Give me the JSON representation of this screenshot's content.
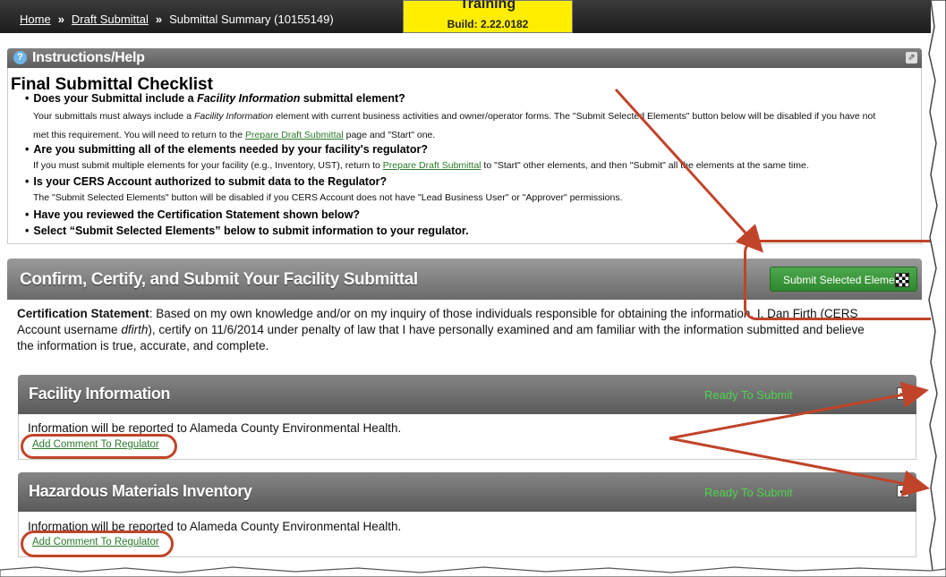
{
  "breadcrumb": {
    "home": "Home",
    "sep": "»",
    "draft": "Draft Submittal",
    "current": "Submittal Summary (10155149)"
  },
  "build_badge": {
    "environment": "Training",
    "build": "Build: 2.22.0182"
  },
  "instructions": {
    "header": "Instructions/Help",
    "checklist_title": "Final Submittal Checklist",
    "items": [
      {
        "q_pre": "Does your Submittal include a ",
        "q_em": "Facility Information",
        "q_post": " submittal element?",
        "d1_pre": "Your submittals must always include a ",
        "d1_em": "Facility Information",
        "d1_post": " element with current business activities and owner/operator forms. The \"Submit Selected Elements\" button below will be disabled if you have not",
        "d2_pre": "met this requirement. You will need to return to the ",
        "d2_link": "Prepare Draft Submittal",
        "d2_post": " page and \"Start\" one."
      },
      {
        "q": "Are you submitting all of the elements needed by your facility's regulator?",
        "d_pre": "If you must submit multiple elements for your facility (e.g., Inventory, UST), return to ",
        "d_link": "Prepare Draft Submittal",
        "d_post": " to \"Start\" other elements, and then \"Submit\" all the elements at the same time."
      },
      {
        "q": "Is your CERS Account authorized to submit data to the Regulator?",
        "d": "The \"Submit Selected Elements\" button will be disabled if you CERS Account does not have \"Lead Business User\" or \"Approver\" permissions."
      },
      {
        "q": "Have you reviewed the Certification Statement shown below?"
      },
      {
        "q": "Select “Submit Selected Elements” below to submit information to your regulator."
      }
    ]
  },
  "confirm": {
    "title": "Confirm, Certify, and Submit Your Facility Submittal",
    "submit_label": "Submit Selected Elements",
    "cert_label": "Certification Statement",
    "cert_1": ": Based on my own knowledge and/or on my inquiry of those individuals responsible for obtaining the information, I, Dan Firth (CERS",
    "cert_2a": "Account username ",
    "cert_2_user": "dfirth",
    "cert_2b": "), certify on 11/6/2014 under penalty of law that I have personally examined and am familiar with the information submitted and believe",
    "cert_3": "the information is true, accurate, and complete."
  },
  "elements": [
    {
      "title": "Facility Information",
      "status": "Ready To Submit",
      "checked": true,
      "info": "Information will be reported to Alameda County Environmental Health.",
      "comment_link": "Add Comment To Regulator"
    },
    {
      "title": "Hazardous Materials Inventory",
      "status": "Ready To Submit",
      "checked": true,
      "info": "Information will be reported to Alameda County Environmental Health.",
      "comment_link": "Add Comment To Regulator"
    }
  ],
  "colors": {
    "annotation": "#c0442a",
    "submit_button": "#3a993a",
    "status_text": "#4ed34e",
    "build_badge": "#ffee00"
  },
  "icons": [
    "help-icon",
    "collapse-icon",
    "checkered-flag-icon",
    "checkbox-icon"
  ]
}
